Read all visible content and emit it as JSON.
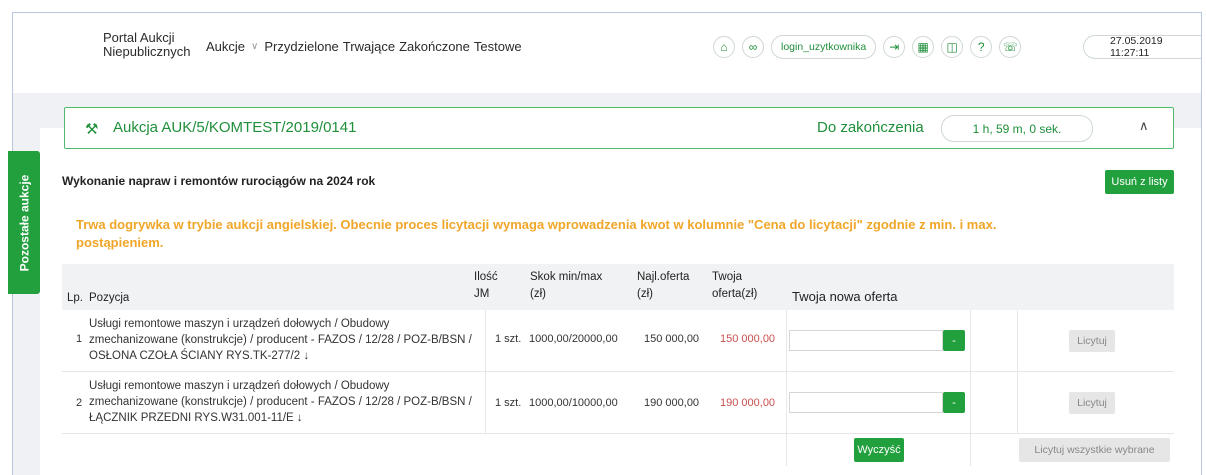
{
  "brand": {
    "line1": "Portal Aukcji",
    "line2": "Niepublicznych"
  },
  "nav": {
    "aukcje": "Aukcje",
    "przydzielone": "Przydzielone",
    "trwajace": "Trwające",
    "zakonczone": "Zakończone",
    "testowe": "Testowe"
  },
  "topbar": {
    "login": "login_uzytkownika",
    "datetime": "27.05.2019 11:27:11"
  },
  "sidetab": {
    "label": "Pozostałe aukcje"
  },
  "auction": {
    "title": "Aukcja AUK/5/KOMTEST/2019/0141",
    "countdown_label": "Do zakończenia",
    "countdown": "1 h, 59 m, 0 sek.",
    "name": "Wykonanie napraw i remontów rurociągów na 2024 rok",
    "remove_label": "Usuń z listy",
    "notice": "Trwa dogrywka w trybie aukcji angielskiej. Obecnie proces licytacji wymaga wprowadzenia kwot w kolumnie \"Cena do licytacji\" zgodnie z min. i max. postąpieniem."
  },
  "table": {
    "headers": {
      "lp": "Lp.",
      "pozycja": "Pozycja",
      "ilosc_1": "Ilość",
      "ilosc_2": "JM",
      "skok_1": "Skok min/max",
      "skok_2": "(zł)",
      "najl_1": "Najl.oferta",
      "najl_2": "(zł)",
      "twoja_1": "Twoja",
      "twoja_2": "oferta(zł)",
      "nowa": "Twoja nowa oferta"
    },
    "rows": [
      {
        "lp": "1",
        "pozycja": "Usługi remontowe maszyn i urządzeń dołowych / Obudowy zmechanizowane (konstrukcje) / producent - FAZOS / 12/28 / POZ-B/BSN / OSŁONA CZOŁA ŚCIANY RYS.TK-277/2 ↓",
        "qty": "1 szt.",
        "range": "1000,00/20000,00",
        "best": "150 000,00",
        "yours": "150 000,00",
        "new_value": "",
        "minus": "-",
        "bid": "Licytuj"
      },
      {
        "lp": "2",
        "pozycja": "Usługi remontowe maszyn i urządzeń dołowych / Obudowy zmechanizowane (konstrukcje) / producent - FAZOS / 12/28 / POZ-B/BSN / ŁĄCZNIK PRZEDNI RYS.W31.001-11/E ↓",
        "qty": "1 szt.",
        "range": "1000,00/10000,00",
        "best": "190 000,00",
        "yours": "190 000,00",
        "new_value": "",
        "minus": "-",
        "bid": "Licytuj"
      }
    ],
    "clear_label": "Wyczyść",
    "bid_all_label": "Licytuj wszystkie wybrane"
  },
  "colors": {
    "accent": "#23a03e",
    "notice": "#f0a628",
    "own_offer": "#c9504f"
  },
  "icons": [
    "home-icon",
    "link-icon",
    "logout-icon",
    "building-icon",
    "book-icon",
    "help-icon",
    "phone-icon",
    "gavel-icon",
    "chevron-up-icon"
  ]
}
